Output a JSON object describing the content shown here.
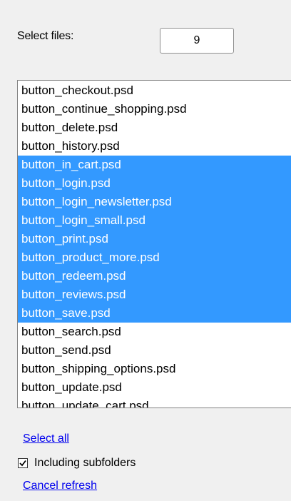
{
  "select_files": {
    "label": "Select files:",
    "count": "9"
  },
  "files": [
    {
      "name": "button_checkout.psd",
      "selected": false
    },
    {
      "name": "button_continue_shopping.psd",
      "selected": false
    },
    {
      "name": "button_delete.psd",
      "selected": false
    },
    {
      "name": "button_history.psd",
      "selected": false
    },
    {
      "name": "button_in_cart.psd",
      "selected": true
    },
    {
      "name": "button_login.psd",
      "selected": true
    },
    {
      "name": "button_login_newsletter.psd",
      "selected": true
    },
    {
      "name": "button_login_small.psd",
      "selected": true
    },
    {
      "name": "button_print.psd",
      "selected": true
    },
    {
      "name": "button_product_more.psd",
      "selected": true
    },
    {
      "name": "button_redeem.psd",
      "selected": true
    },
    {
      "name": "button_reviews.psd",
      "selected": true
    },
    {
      "name": "button_save.psd",
      "selected": true
    },
    {
      "name": "button_search.psd",
      "selected": false
    },
    {
      "name": "button_send.psd",
      "selected": false
    },
    {
      "name": "button_shipping_options.psd",
      "selected": false
    },
    {
      "name": "button_update.psd",
      "selected": false
    },
    {
      "name": "button_update_cart.psd",
      "selected": false
    }
  ],
  "actions": {
    "select_all": "Select all",
    "including_subfolders": "Including subfolders",
    "including_subfolders_checked": true,
    "cancel_refresh": "Cancel refresh"
  },
  "colors": {
    "selection": "#3399ff",
    "link": "#0000ee",
    "background": "#f0f0f0"
  }
}
